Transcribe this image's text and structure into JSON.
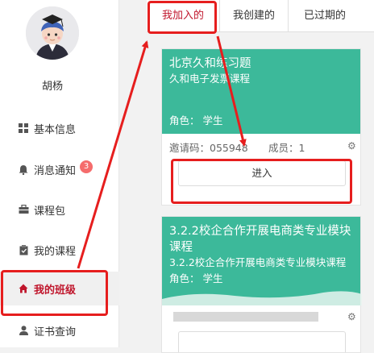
{
  "user": {
    "name": "胡杨"
  },
  "sidebar": {
    "items": [
      {
        "label": "基本信息",
        "icon": "grid-icon"
      },
      {
        "label": "消息通知",
        "icon": "bell-icon",
        "badge": "3"
      },
      {
        "label": "课程包",
        "icon": "briefcase-icon"
      },
      {
        "label": "我的课程",
        "icon": "clipboard-icon"
      },
      {
        "label": "我的班级",
        "icon": "home-icon",
        "active": true
      },
      {
        "label": "证书查询",
        "icon": "person-icon"
      }
    ]
  },
  "tabs": [
    {
      "label": "我加入的",
      "active": true
    },
    {
      "label": "我创建的"
    },
    {
      "label": "已过期的"
    }
  ],
  "cards": [
    {
      "title": "北京久和练习题",
      "subtitle": "久和电子发票课程",
      "role": "角色：  学生",
      "code": "邀请码：055948",
      "members": "成员：1",
      "button": "进入"
    },
    {
      "title": "3.2.2校企合作开展电商类专业模块课程",
      "subtitle": "3.2.2校企合作开展电商类专业模块课程",
      "role": "角色：  学生"
    }
  ],
  "colors": {
    "accent": "#c0162c",
    "card_header": "#3cb99a",
    "annotation": "#e61e1e",
    "badge": "#f56c6c"
  }
}
